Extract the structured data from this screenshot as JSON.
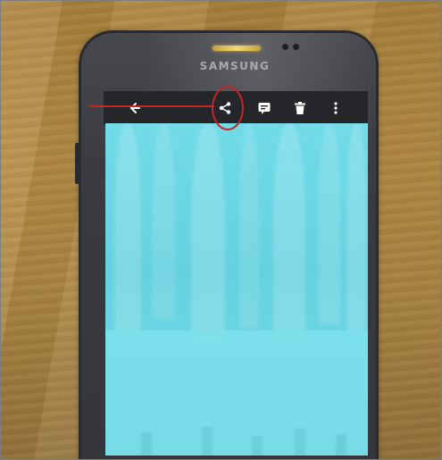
{
  "photo": {
    "brand_label": "SAMSUNG"
  },
  "toolbar": {
    "icons": [
      "back-arrow-icon",
      "share-icon",
      "edit-icon",
      "delete-icon",
      "more-vertical-icon"
    ],
    "highlighted": "share-icon",
    "background": "#25262a",
    "icon_color": "#ffffff"
  },
  "annotation": {
    "color": "#c42525",
    "target": "share-icon"
  },
  "colors": {
    "table_wood": "#a8823e",
    "phone_body": "#3a3c42",
    "screen_cyan": "#6ad5e2",
    "speaker_glow": "#f2d77a"
  }
}
